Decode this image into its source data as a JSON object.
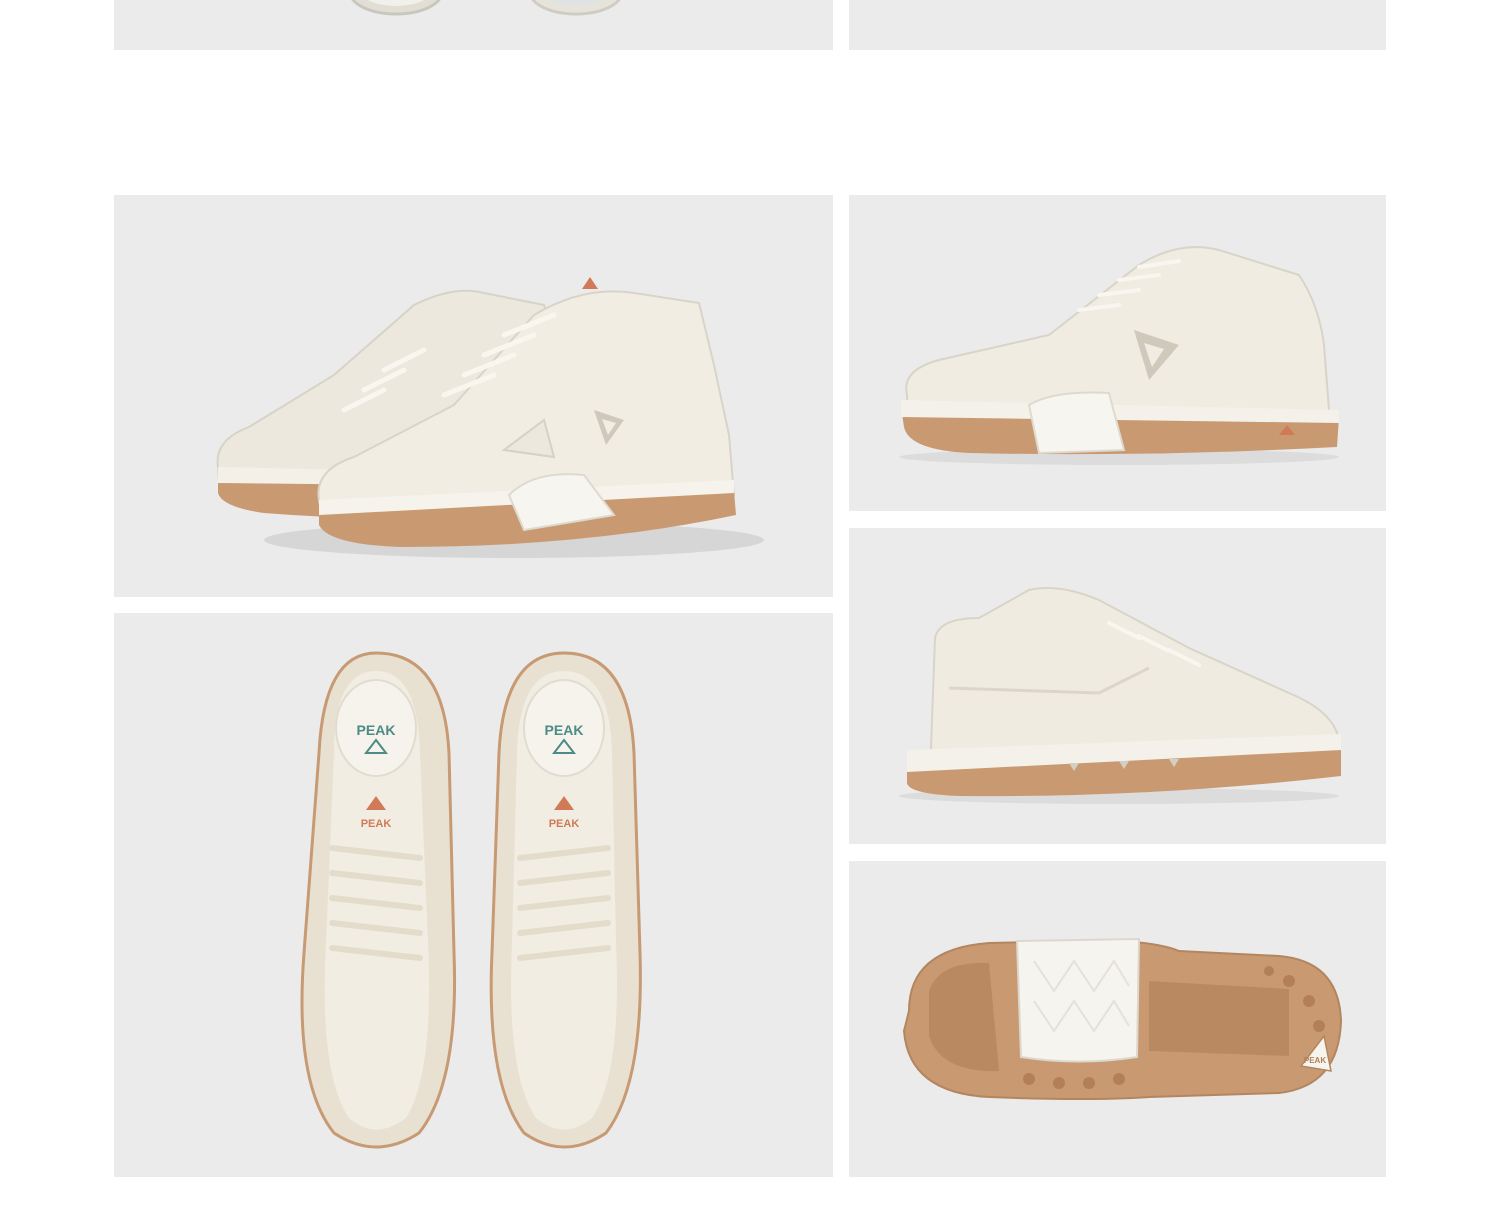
{
  "brand": {
    "logo_text": "PEAK"
  },
  "colors": {
    "panel_bg": "#ebebeb",
    "shoe_cream": "#efebe1",
    "sole_gum": "#c99a72",
    "logo_accent": "#d07a58",
    "insole_teal": "#4c8b86"
  }
}
